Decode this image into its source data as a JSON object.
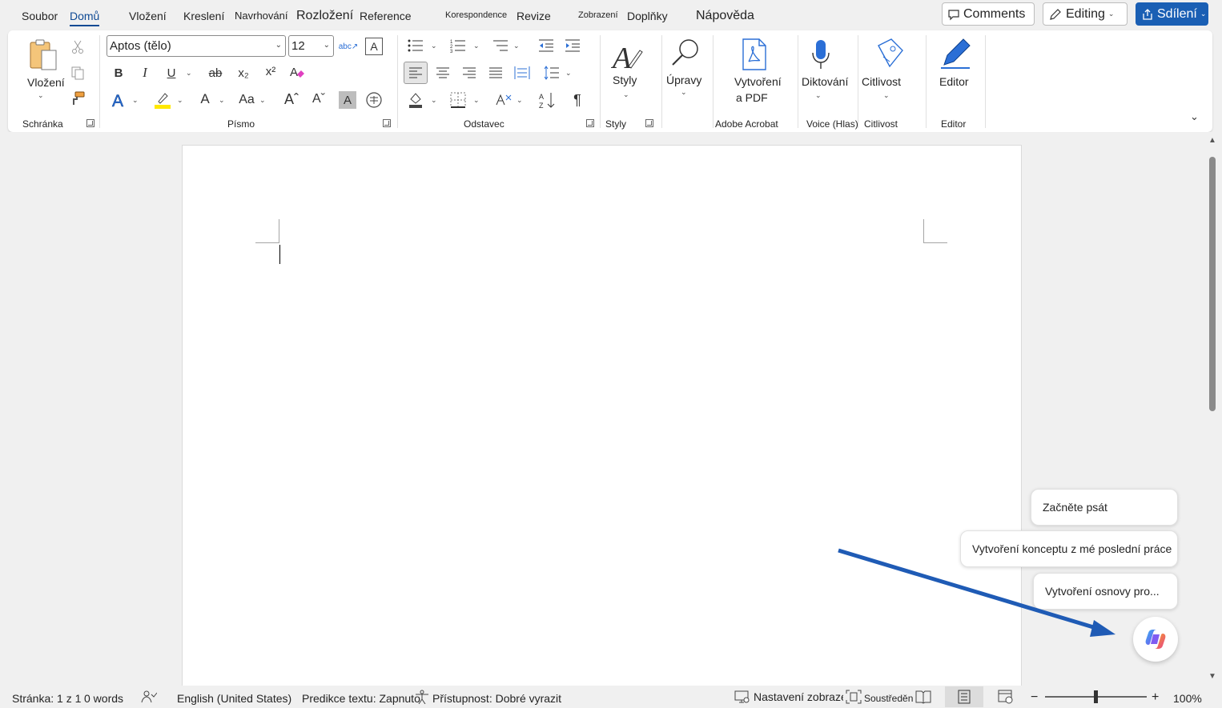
{
  "tabs": [
    {
      "label": "Soubor"
    },
    {
      "label": "Domů"
    },
    {
      "label": "Vložení"
    },
    {
      "label": "Kreslení"
    },
    {
      "label": "Navrhování"
    },
    {
      "label": "Rozložení"
    },
    {
      "label": "Reference"
    },
    {
      "label": "Korespondence"
    },
    {
      "label": "Revize"
    },
    {
      "label": "Zobrazení"
    },
    {
      "label": "Doplňky"
    },
    {
      "label": "Nápověda"
    }
  ],
  "header": {
    "comments_label": "Comments",
    "editing_label": "Editing",
    "share_label": "Sdílení"
  },
  "ribbon": {
    "clipboard": {
      "paste_label": "Vložení",
      "group_label": "Schránka"
    },
    "font": {
      "font_name": "Aptos (tělo)",
      "font_size": "12",
      "group_label": "Písmo",
      "bold": "B",
      "italic": "I",
      "underline": "U",
      "strike": "ab",
      "subscript": "x₂",
      "superscript": "x²",
      "font_color_glyph": "A",
      "case": "Aa"
    },
    "paragraph": {
      "group_label": "Odstavec"
    },
    "styles": {
      "label": "Styly",
      "group_label": "Styly"
    },
    "editing": {
      "label": "Úpravy"
    },
    "acrobat": {
      "label_line1": "Vytvoření",
      "label_line2": "a PDF",
      "group_label": "Adobe Acrobat"
    },
    "voice": {
      "label": "Diktování",
      "group_label": "Voice (Hlas)"
    },
    "sensitivity": {
      "label": "Citlivost",
      "group_label": "Citlivost"
    },
    "editor": {
      "label": "Editor",
      "group_label": "Editor"
    }
  },
  "suggestions": [
    {
      "label": "Začněte psát"
    },
    {
      "label": "Vytvoření konceptu z mé poslední práce"
    },
    {
      "label": "Vytvoření osnovy pro..."
    }
  ],
  "status": {
    "page": "Stránka: 1 z 1",
    "words": "0 words",
    "language": "English (United States)",
    "prediction": "Predikce textu: Zapnuto",
    "accessibility": "Přístupnost: Dobré vyrazit",
    "display_settings": "Nastavení zobrazení",
    "focus": "Soustředění",
    "zoom": "100%",
    "zoom_minus": "−",
    "zoom_plus": "+"
  },
  "colors": {
    "accent": "#1a5fb4",
    "active_tab": "#0f4a94",
    "arrow": "#1f5bb5",
    "highlight_yellow": "#ffe800",
    "font_color_blue": "#2b6fd6"
  },
  "icons": [
    "paste-icon",
    "cut-icon",
    "copy-icon",
    "format-painter-icon",
    "clear-format-icon",
    "bullets-icon",
    "numbering-icon",
    "multilevel-icon",
    "decrease-indent-icon",
    "increase-indent-icon",
    "align-left-icon",
    "align-center-icon",
    "align-right-icon",
    "justify-icon",
    "line-spacing-icon",
    "shading-icon",
    "borders-icon",
    "sort-icon",
    "pilcrow-icon",
    "styles-icon",
    "search-icon",
    "pdf-icon",
    "microphone-icon",
    "sensitivity-icon",
    "editor-icon",
    "copilot-icon"
  ]
}
